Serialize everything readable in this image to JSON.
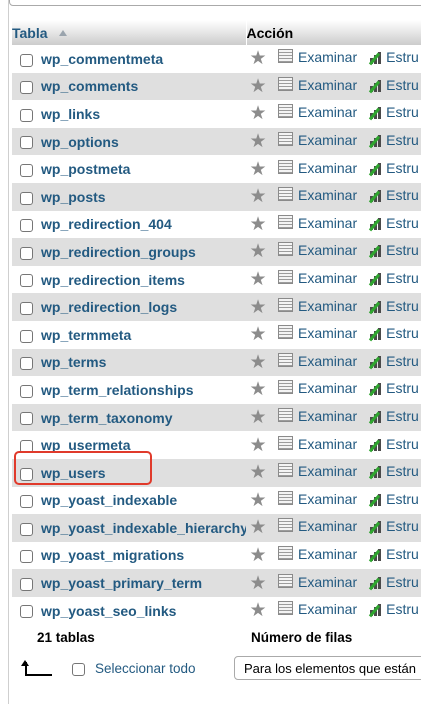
{
  "header": {
    "col_table": "Tabla",
    "col_action": "Acción"
  },
  "actions": {
    "browse_label": "Examinar",
    "structure_label": "Estru"
  },
  "rows": [
    {
      "name": "wp_commentmeta"
    },
    {
      "name": "wp_comments"
    },
    {
      "name": "wp_links"
    },
    {
      "name": "wp_options"
    },
    {
      "name": "wp_postmeta"
    },
    {
      "name": "wp_posts"
    },
    {
      "name": "wp_redirection_404"
    },
    {
      "name": "wp_redirection_groups"
    },
    {
      "name": "wp_redirection_items"
    },
    {
      "name": "wp_redirection_logs"
    },
    {
      "name": "wp_termmeta"
    },
    {
      "name": "wp_terms"
    },
    {
      "name": "wp_term_relationships"
    },
    {
      "name": "wp_term_taxonomy"
    },
    {
      "name": "wp_usermeta"
    },
    {
      "name": "wp_users"
    },
    {
      "name": "wp_yoast_indexable"
    },
    {
      "name": "wp_yoast_indexable_hierarchy"
    },
    {
      "name": "wp_yoast_migrations"
    },
    {
      "name": "wp_yoast_primary_term"
    },
    {
      "name": "wp_yoast_seo_links"
    }
  ],
  "summary": {
    "table_count": "21 tablas",
    "rows_header": "Número de filas"
  },
  "footer": {
    "select_all": "Seleccionar todo",
    "with_selected": "Para los elementos que están"
  },
  "highlighted_row": "wp_users",
  "colors": {
    "link": "#235a81",
    "highlight": "#e03a2b",
    "row_alt": "#dfdfdf"
  },
  "icons": [
    "checkbox",
    "favorite-star-icon",
    "browse-icon",
    "structure-icon",
    "select-all-arrow-icon"
  ]
}
